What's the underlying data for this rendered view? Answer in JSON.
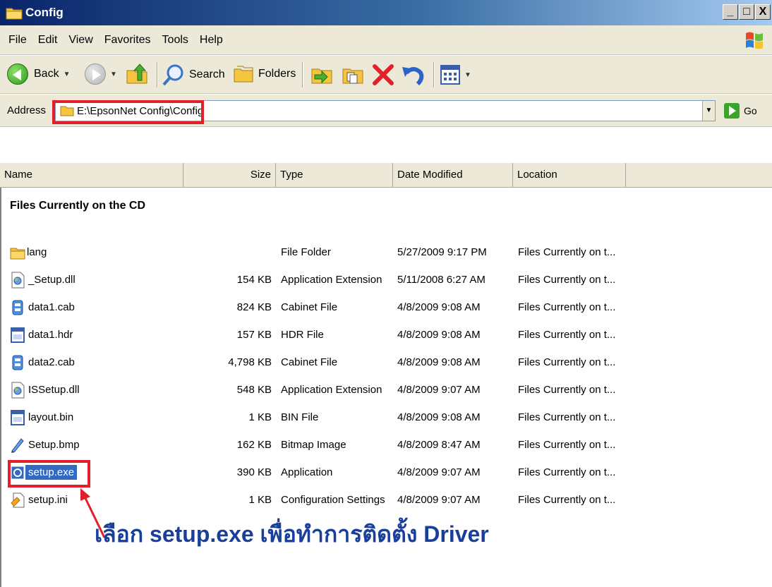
{
  "window": {
    "title": "Config",
    "minimize": "_",
    "maximize": "□",
    "close": "X"
  },
  "menu": [
    "File",
    "Edit",
    "View",
    "Favorites",
    "Tools",
    "Help"
  ],
  "toolbar": {
    "back": "Back",
    "search": "Search",
    "folders": "Folders"
  },
  "address": {
    "label": "Address",
    "value": "E:\\EpsonNet Config\\Config",
    "go": "Go"
  },
  "columns": [
    "Name",
    "Size",
    "Type",
    "Date Modified",
    "Location"
  ],
  "group_title": "Files Currently on the CD",
  "files": [
    {
      "name": "lang",
      "size": "",
      "type": "File Folder",
      "date": "5/27/2009 9:17 PM",
      "location": "Files Currently on t...",
      "icon": "folder-icon"
    },
    {
      "name": "_Setup.dll",
      "size": "154 KB",
      "type": "Application Extension",
      "date": "5/11/2008 6:27 AM",
      "location": "Files Currently on t...",
      "icon": "dll-icon"
    },
    {
      "name": "data1.cab",
      "size": "824 KB",
      "type": "Cabinet File",
      "date": "4/8/2009 9:08 AM",
      "location": "Files Currently on t...",
      "icon": "cabinet-icon"
    },
    {
      "name": "data1.hdr",
      "size": "157 KB",
      "type": "HDR File",
      "date": "4/8/2009 9:08 AM",
      "location": "Files Currently on t...",
      "icon": "generic-file-icon"
    },
    {
      "name": "data2.cab",
      "size": "4,798 KB",
      "type": "Cabinet File",
      "date": "4/8/2009 9:08 AM",
      "location": "Files Currently on t...",
      "icon": "cabinet-icon"
    },
    {
      "name": "ISSetup.dll",
      "size": "548 KB",
      "type": "Application Extension",
      "date": "4/8/2009 9:07 AM",
      "location": "Files Currently on t...",
      "icon": "dll-icon"
    },
    {
      "name": "layout.bin",
      "size": "1 KB",
      "type": "BIN File",
      "date": "4/8/2009 9:08 AM",
      "location": "Files Currently on t...",
      "icon": "generic-file-icon"
    },
    {
      "name": "Setup.bmp",
      "size": "162 KB",
      "type": "Bitmap Image",
      "date": "4/8/2009 8:47 AM",
      "location": "Files Currently on t...",
      "icon": "bitmap-icon"
    },
    {
      "name": "setup.exe",
      "size": "390 KB",
      "type": "Application",
      "date": "4/8/2009 9:07 AM",
      "location": "Files Currently on t...",
      "icon": "application-icon",
      "selected": true
    },
    {
      "name": "setup.ini",
      "size": "1 KB",
      "type": "Configuration Settings",
      "date": "4/8/2009 9:07 AM",
      "location": "Files Currently on t...",
      "icon": "settings-file-icon"
    }
  ],
  "annotation": "เลือก setup.exe เพื่อทำการติดตั้ง Driver",
  "colors": {
    "highlight": "#e0202a",
    "annotation": "#1a3f9a",
    "selection": "#316ac5"
  }
}
